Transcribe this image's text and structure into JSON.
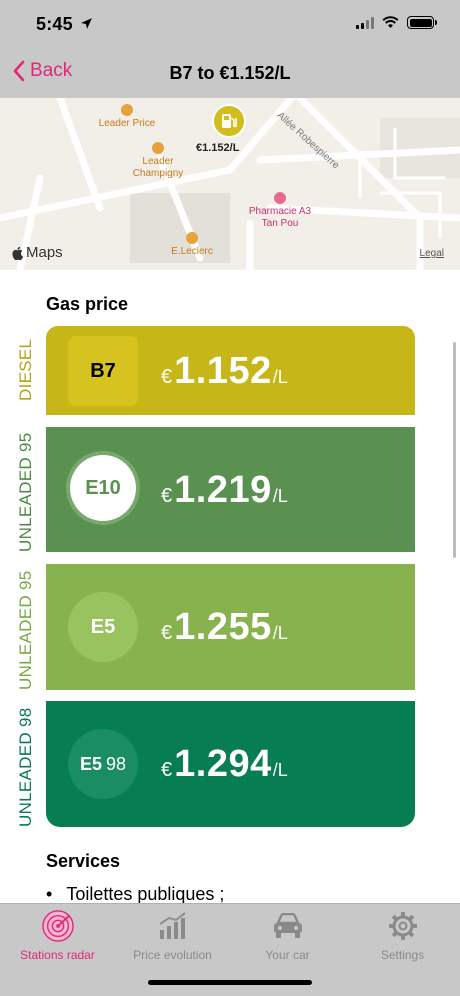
{
  "status": {
    "time": "5:45"
  },
  "nav": {
    "back_label": "Back",
    "title": "B7 to €1.152/L"
  },
  "map": {
    "pin_label": "€1.152/L",
    "pois": [
      {
        "label": "Leader Price"
      },
      {
        "label": "Leader Champigny"
      },
      {
        "label": "Pharmacie A3 Tan Pou"
      },
      {
        "label": "E.Leclerc"
      }
    ],
    "road_label": "Allée Robespierre",
    "brand": "Maps",
    "legal": "Legal"
  },
  "gas_price": {
    "title": "Gas price",
    "fuels": [
      {
        "category": "DIESEL",
        "code": "B7",
        "code_sub": "",
        "currency": "€",
        "price": "1.152",
        "unit": "/L",
        "color": "#c7b618",
        "label_color": "#b5a31a",
        "badge_color": "#d6c320"
      },
      {
        "category": "UNLEADED 95",
        "code": "E10",
        "code_sub": "",
        "currency": "€",
        "price": "1.219",
        "unit": "/L",
        "color": "#5a9150",
        "label_color": "#4d8a45",
        "badge_color": "#ffffff"
      },
      {
        "category": "UNLEADED 95",
        "code": "E5",
        "code_sub": "",
        "currency": "€",
        "price": "1.255",
        "unit": "/L",
        "color": "#87b24e",
        "label_color": "#7aa845",
        "badge_color": "#99c35f"
      },
      {
        "category": "UNLEADED 98",
        "code": "E5",
        "code_sub": "98",
        "currency": "€",
        "price": "1.294",
        "unit": "/L",
        "color": "#077e52",
        "label_color": "#0b7a50",
        "badge_color": "#1a8e62"
      }
    ]
  },
  "services": {
    "title": "Services",
    "items": [
      "Toilettes publiques ;"
    ]
  },
  "tabs": [
    {
      "label": "Stations radar",
      "icon": "radar-icon",
      "active": true
    },
    {
      "label": "Price evolution",
      "icon": "chart-icon",
      "active": false
    },
    {
      "label": "Your car",
      "icon": "car-icon",
      "active": false
    },
    {
      "label": "Settings",
      "icon": "gear-icon",
      "active": false
    }
  ],
  "colors": {
    "accent": "#e0287a",
    "bars": "#c8c8c8"
  }
}
